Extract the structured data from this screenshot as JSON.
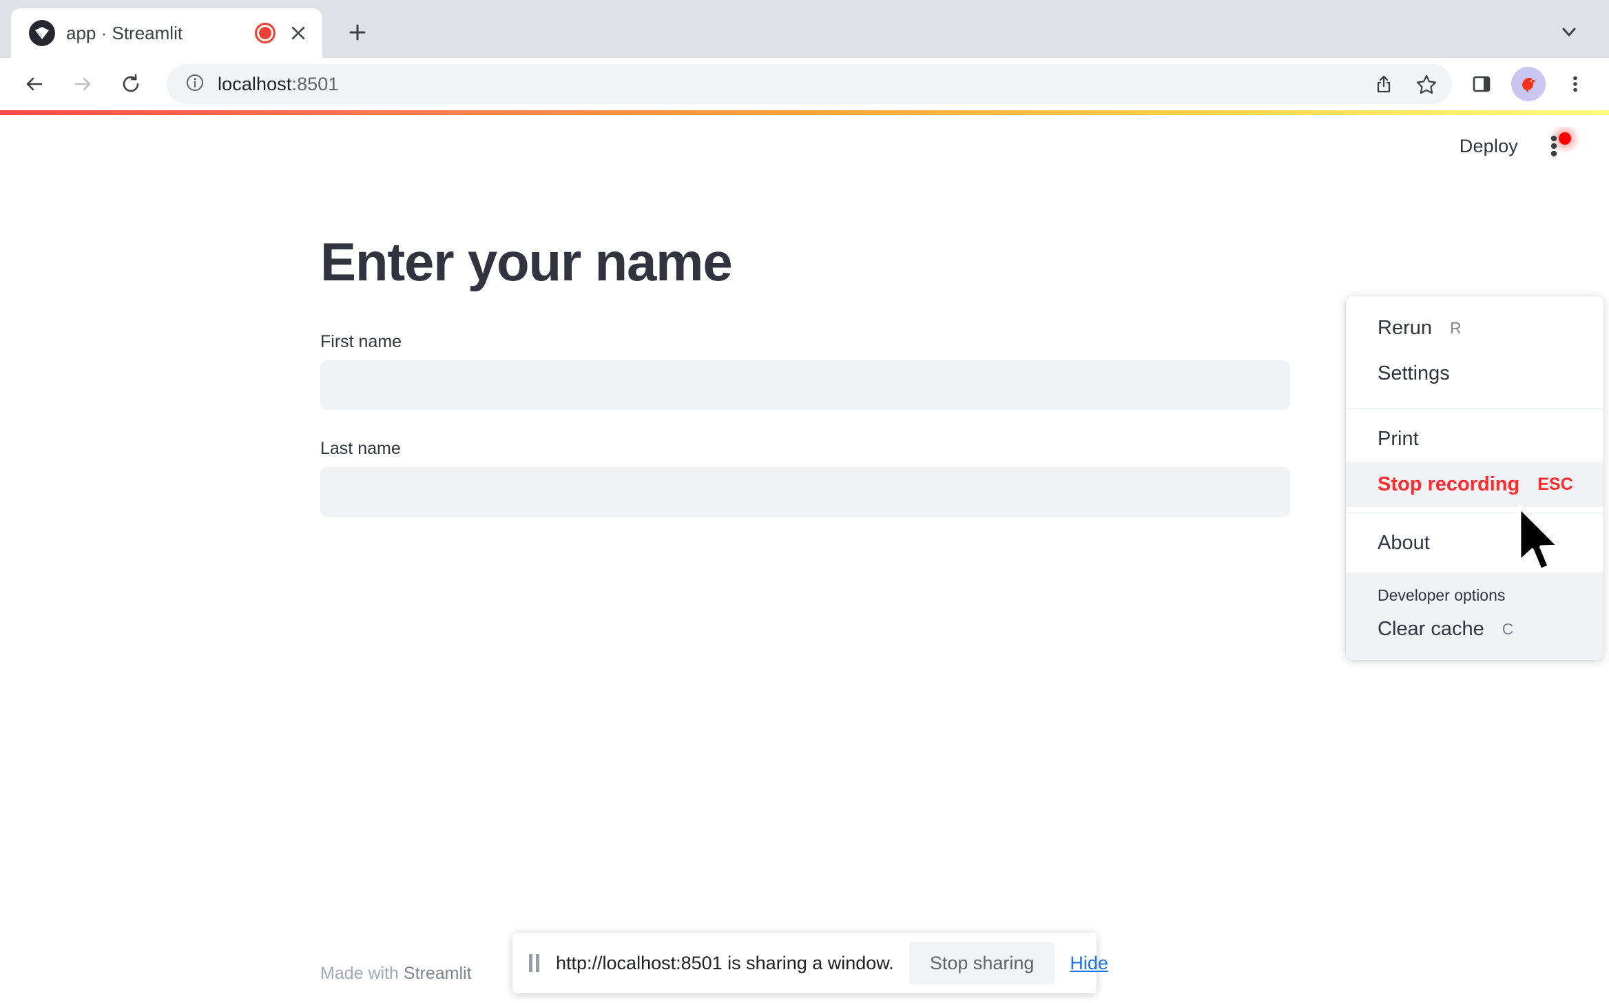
{
  "browser": {
    "tab": {
      "title": "app · Streamlit",
      "favicon_icon": "streamlit-crown-icon",
      "recording_icon": "record-dot-icon",
      "close_icon": "close-icon"
    },
    "new_tab_icon": "plus-icon",
    "tabstrip_chevron_icon": "chevron-down-icon",
    "nav": {
      "back_icon": "arrow-left-icon",
      "forward_icon": "arrow-right-icon",
      "reload_icon": "reload-icon"
    },
    "omnibox": {
      "info_icon": "info-circle-icon",
      "url_host": "localhost",
      "url_port": ":8501",
      "share_icon": "share-icon",
      "bookmark_icon": "star-icon"
    },
    "toolbar": {
      "side_panel_icon": "side-panel-icon",
      "profile_avatar_icon": "bird-avatar-icon",
      "chrome_menu_icon": "three-dots-vertical-icon"
    }
  },
  "app": {
    "header": {
      "deploy_label": "Deploy",
      "menu_icon": "streamlit-three-dots-recording-icon"
    },
    "title": "Enter your name",
    "fields": [
      {
        "label": "First name",
        "value": "",
        "placeholder": ""
      },
      {
        "label": "Last name",
        "value": "",
        "placeholder": ""
      }
    ],
    "footer": {
      "prefix": "Made with ",
      "brand": "Streamlit"
    },
    "menu": {
      "groups": [
        {
          "items": [
            {
              "label": "Rerun",
              "shortcut": "R",
              "danger": false
            },
            {
              "label": "Settings",
              "shortcut": "",
              "danger": false
            }
          ]
        },
        {
          "items": [
            {
              "label": "Print",
              "shortcut": "",
              "danger": false
            },
            {
              "label": "Stop recording",
              "shortcut": "ESC",
              "danger": true
            }
          ]
        },
        {
          "items": [
            {
              "label": "About",
              "shortcut": "",
              "danger": false
            }
          ]
        }
      ],
      "developer": {
        "section_label": "Developer options",
        "items": [
          {
            "label": "Clear cache",
            "shortcut": "C"
          }
        ]
      },
      "danger_color": "#ff2b2b",
      "highlight_color": "#f0f2f6"
    }
  },
  "sharebar": {
    "pause_icon": "pause-icon",
    "message": "http://localhost:8501 is sharing a window.",
    "stop_label": "Stop sharing",
    "hide_label": "Hide",
    "link_color": "#1a73e8"
  },
  "cursor": {
    "icon": "arrow-cursor-icon"
  },
  "theme": {
    "accent_red": "#ff4b4b",
    "accent_yellow": "#fffd80",
    "text_dark": "#31333f",
    "input_bg": "#f0f2f6"
  }
}
